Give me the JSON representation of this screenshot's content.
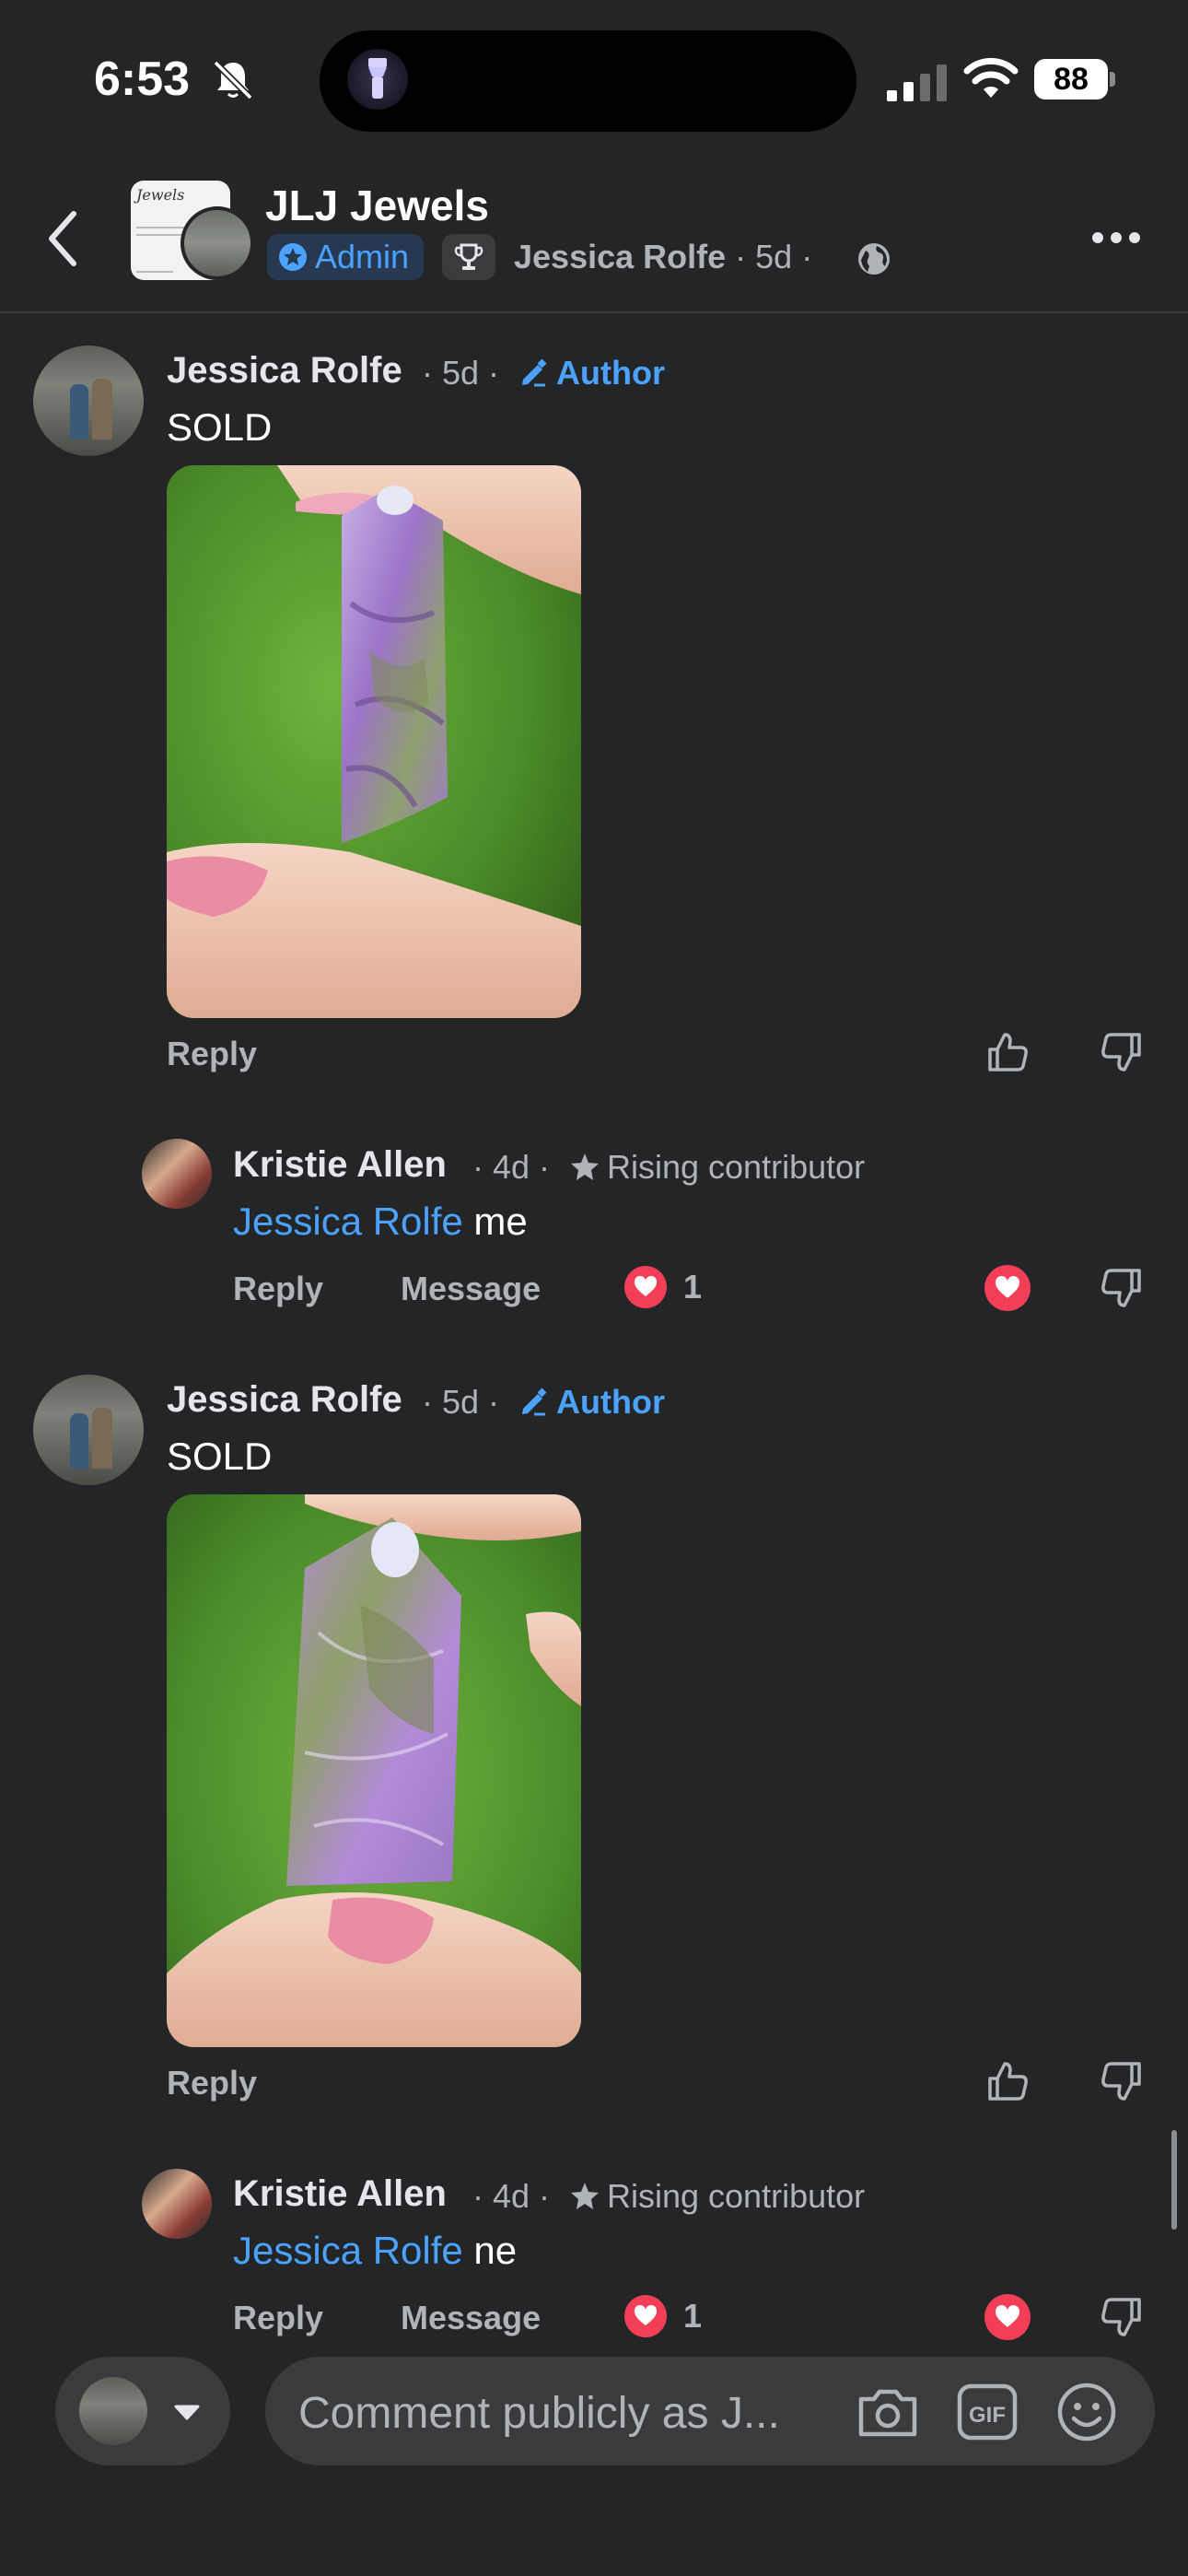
{
  "status_bar": {
    "time": "6:53",
    "battery": "88"
  },
  "header": {
    "group_name": "JLJ Jewels",
    "group_thumb_text": "Jewels",
    "role_badge": "Admin",
    "poster": "Jessica Rolfe",
    "age": "5d"
  },
  "comments": [
    {
      "name": "Jessica Rolfe",
      "meta": "· 5d ·",
      "badge": "Author",
      "text": "SOLD",
      "reply": "Reply"
    },
    {
      "name": "Kristie Allen",
      "meta": "· 4d ·",
      "badge": "Rising contributor",
      "mention": "Jessica Rolfe",
      "text": " me",
      "reply": "Reply",
      "message": "Message",
      "reaction_count": "1"
    },
    {
      "name": "Jessica Rolfe",
      "meta": "· 5d ·",
      "badge": "Author",
      "text": "SOLD",
      "reply": "Reply"
    },
    {
      "name": "Kristie Allen",
      "meta": "· 4d ·",
      "badge": "Rising contributor",
      "mention": "Jessica Rolfe",
      "text": " ne",
      "reply": "Reply",
      "message": "Message",
      "reaction_count": "1"
    }
  ],
  "composer": {
    "placeholder": "Comment publicly as J..."
  },
  "colors": {
    "background": "#242526",
    "accent": "#4ba3ff",
    "heart": "#f33e58",
    "text_secondary": "#b0b3b8"
  }
}
